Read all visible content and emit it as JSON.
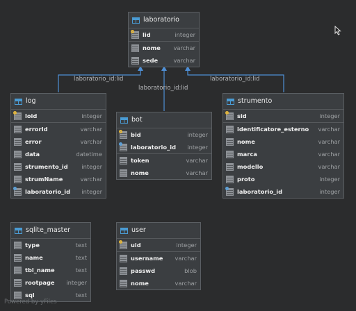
{
  "tables": {
    "laboratorio": {
      "name": "laboratorio",
      "columns": [
        {
          "name": "lid",
          "type": "integer",
          "key": "pk"
        },
        {
          "name": "nome",
          "type": "varchar",
          "key": ""
        },
        {
          "name": "sede",
          "type": "varchar",
          "key": ""
        }
      ]
    },
    "log": {
      "name": "log",
      "columns": [
        {
          "name": "loid",
          "type": "integer",
          "key": "pk"
        },
        {
          "name": "errorId",
          "type": "varchar",
          "key": ""
        },
        {
          "name": "error",
          "type": "varchar",
          "key": ""
        },
        {
          "name": "data",
          "type": "datetime",
          "key": ""
        },
        {
          "name": "strumento_id",
          "type": "integer",
          "key": ""
        },
        {
          "name": "strumName",
          "type": "varchar",
          "key": ""
        },
        {
          "name": "laboratorio_id",
          "type": "integer",
          "key": "fk"
        }
      ]
    },
    "bot": {
      "name": "bot",
      "columns": [
        {
          "name": "bid",
          "type": "integer",
          "key": "pk"
        },
        {
          "name": "laboratorio_id",
          "type": "integer",
          "key": "fk"
        },
        {
          "name": "token",
          "type": "varchar",
          "key": ""
        },
        {
          "name": "nome",
          "type": "varchar",
          "key": ""
        }
      ]
    },
    "strumento": {
      "name": "strumento",
      "columns": [
        {
          "name": "sid",
          "type": "integer",
          "key": "pk"
        },
        {
          "name": "identificatore_esterno",
          "type": "varchar",
          "key": ""
        },
        {
          "name": "nome",
          "type": "varchar",
          "key": ""
        },
        {
          "name": "marca",
          "type": "varchar",
          "key": ""
        },
        {
          "name": "modello",
          "type": "varchar",
          "key": ""
        },
        {
          "name": "proto",
          "type": "integer",
          "key": ""
        },
        {
          "name": "laboratorio_id",
          "type": "integer",
          "key": "fk"
        }
      ]
    },
    "sqlite_master": {
      "name": "sqlite_master",
      "columns": [
        {
          "name": "type",
          "type": "text",
          "key": ""
        },
        {
          "name": "name",
          "type": "text",
          "key": ""
        },
        {
          "name": "tbl_name",
          "type": "text",
          "key": ""
        },
        {
          "name": "rootpage",
          "type": "integer",
          "key": ""
        },
        {
          "name": "sql",
          "type": "text",
          "key": ""
        }
      ]
    },
    "user": {
      "name": "user",
      "columns": [
        {
          "name": "uid",
          "type": "integer",
          "key": "pk"
        },
        {
          "name": "username",
          "type": "varchar",
          "key": ""
        },
        {
          "name": "passwd",
          "type": "blob",
          "key": ""
        },
        {
          "name": "nome",
          "type": "varchar",
          "key": ""
        }
      ]
    }
  },
  "relations": [
    {
      "from": "log",
      "to": "laboratorio",
      "label": "laboratorio_id:lid"
    },
    {
      "from": "bot",
      "to": "laboratorio",
      "label": "laboratorio_id:lid"
    },
    {
      "from": "strumento",
      "to": "laboratorio",
      "label": "laboratorio_id:lid"
    }
  ],
  "watermark": "Powered by yFiles",
  "colors": {
    "background": "#2b2c2d",
    "edge": "#4e8fd6",
    "pk": "#e2b53a",
    "fk": "#5aa0d9"
  }
}
